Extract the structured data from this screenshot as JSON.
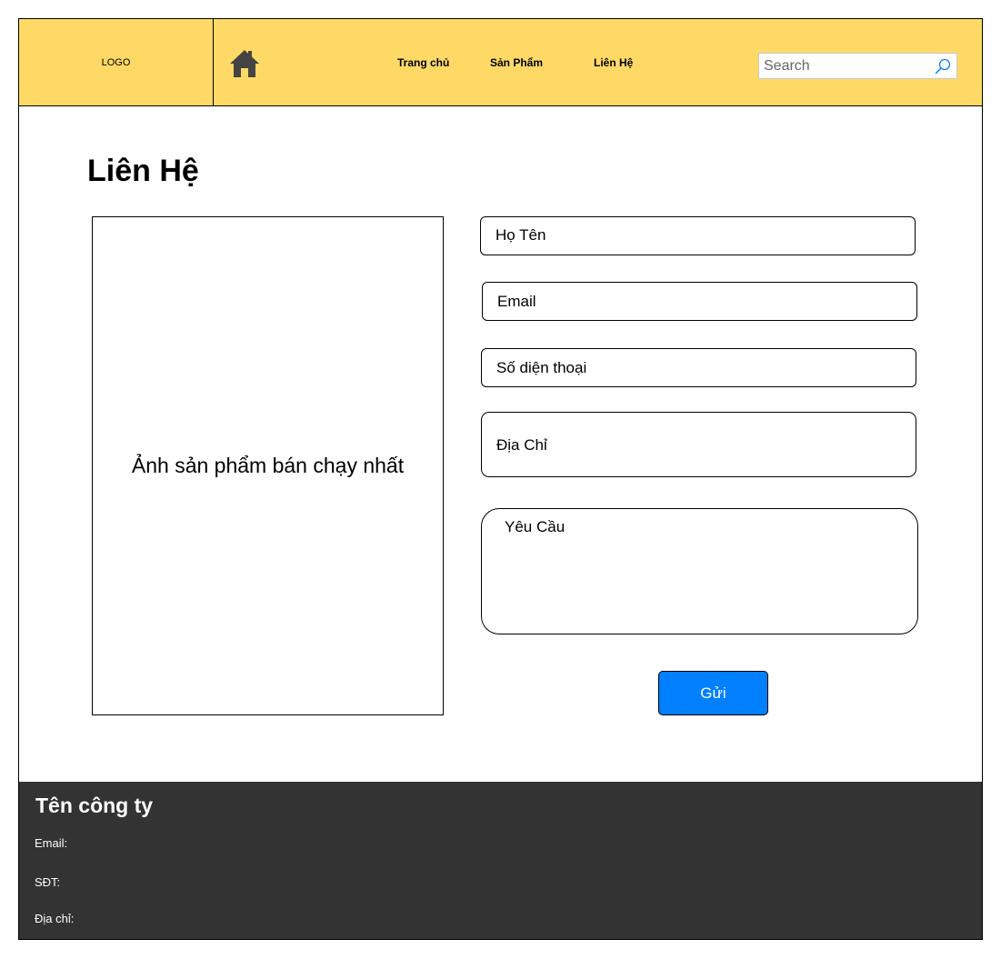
{
  "header": {
    "logo_text": "LOGO",
    "home_icon": "home-icon",
    "nav": [
      "Trang chủ",
      "Sản Phẩm",
      "Liên Hệ"
    ],
    "search_placeholder": "Search",
    "search_icon": "search-icon",
    "background_color": "#ffd966"
  },
  "main": {
    "title": "Liên Hệ",
    "image_placeholder": "Ảnh sản phẩm bán chạy nhất",
    "form": {
      "name_label": "Họ Tên",
      "email_label": "Email",
      "phone_label": "Số diện thoại",
      "address_label": "Địa Chỉ",
      "request_label": "Yêu Cầu",
      "submit_label": "Gửi",
      "submit_color": "#007fff"
    }
  },
  "footer": {
    "company": "Tên công ty",
    "email_label": "Email:",
    "phone_label": "SĐT:",
    "address_label": "Địa chỉ:",
    "background_color": "#333333"
  }
}
